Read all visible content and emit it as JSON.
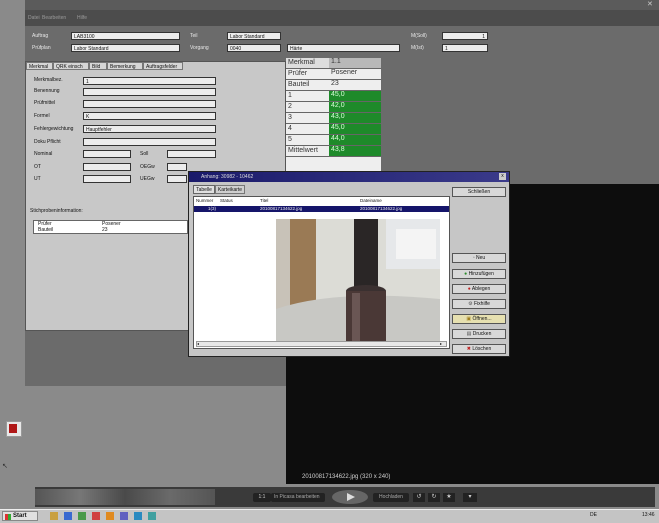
{
  "menu": {
    "items": [
      "Datei",
      "Bearbeiten",
      "Hilfe"
    ]
  },
  "header": {
    "auftrag_label": "Auftrag",
    "auftrag_value": "LAB3100",
    "pruefplan_label": "Prüfplan",
    "pruefplan_value": "Labor Standard",
    "teil_label": "Teil",
    "teil_value": "Labor Standard",
    "vorgang_label": "Vorgang",
    "vorgang_value": "0040",
    "haerte_value": "Härte",
    "msoll_label": "M(Soll)",
    "msoll_value": "1",
    "mist_label": "M(Ist)",
    "mist_value": "1"
  },
  "tabs": [
    "Merkmal",
    "QRK einsch",
    "Bild",
    "Bemerkung",
    "Auftragsfelder"
  ],
  "form": {
    "merkmalbez_label": "Merkmalbez.",
    "merkmalbez_value": "1",
    "benennung_label": "Benennung",
    "pruefmittel_label": "Prüfmittel",
    "formel_label": "Formel",
    "formel_value": "K",
    "fehlergewichtung_label": "Fehlergewichtung",
    "fehlergewichtung_value": "Hauptfehler",
    "dokupflicht_label": "Doku Pflicht",
    "nominal_label": "Nominal",
    "ot_label": "OT",
    "ut_label": "UT",
    "soll_label": "Soll",
    "oegw_label": "OEGw",
    "uegw_label": "UEGw"
  },
  "stichprobe": {
    "title": "Stichprobeninformation:",
    "rows": [
      {
        "key": "Prüfer",
        "value": "Posener"
      },
      {
        "key": "Bauteil",
        "value": "23"
      }
    ]
  },
  "grid": {
    "header": {
      "key": "Merkmal",
      "value": "1.1"
    },
    "rows": [
      {
        "key": "Prüfer",
        "value": "Posener",
        "green": false
      },
      {
        "key": "Bauteil",
        "value": "23",
        "green": false
      },
      {
        "key": "1",
        "value": "45,0",
        "green": true
      },
      {
        "key": "2",
        "value": "42,0",
        "green": true
      },
      {
        "key": "3",
        "value": "43,0",
        "green": true
      },
      {
        "key": "4",
        "value": "45,0",
        "green": true
      },
      {
        "key": "5",
        "value": "44,0",
        "green": true
      },
      {
        "key": "Mittelwert",
        "value": "43,8",
        "green": true
      }
    ]
  },
  "dialog": {
    "title": "Anhang: 30982 - 10462",
    "close": "x",
    "tabs": [
      "Tabelle",
      "Karteikarte"
    ],
    "columns": [
      "Nummer",
      "Status",
      "Titel",
      "Dateiname"
    ],
    "row": {
      "nummer": "1(3)",
      "status": "",
      "titel": "2010081713462​2.jpg",
      "dateiname": "20100817134622.jpg"
    },
    "buttons": {
      "schliessen": "Schließen",
      "neu": "Neu",
      "hinzufuegen": "Hinzufügen",
      "ablegen": "Ablegen",
      "fixhilfe": "Fixhilfe",
      "oeffnen": "Öffnen...",
      "drucken": "Drucken",
      "loeschen": "Löschen"
    }
  },
  "viewer": {
    "caption": "20100817134622.jpg (320 x 240)",
    "zoom": "1:1",
    "edit_label": "In Picasa bearbeiten",
    "upload_label": "Hochladen"
  },
  "taskbar": {
    "start": "Start",
    "lang": "DE",
    "clock": "13:46"
  },
  "colors": {
    "green": "#1e8a2a",
    "dialog_title": "#1a1a6a",
    "selection": "#15156a"
  }
}
